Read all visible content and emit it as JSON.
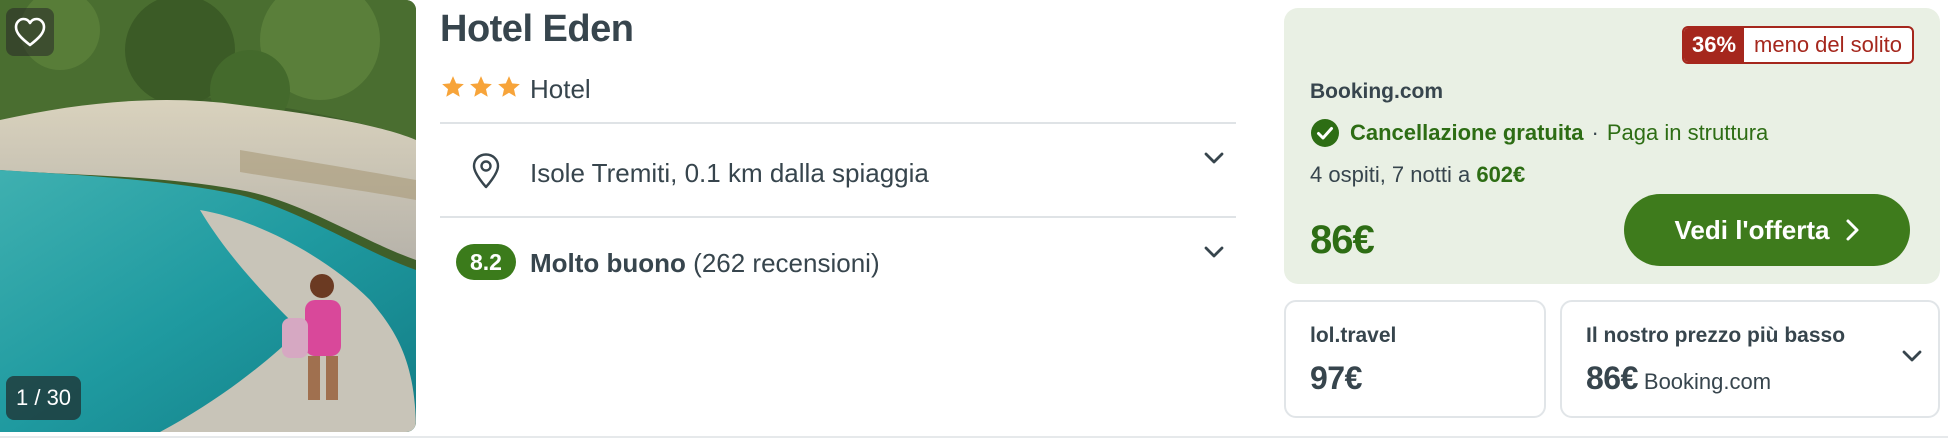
{
  "photo": {
    "counter": "1 / 30",
    "favorite_icon": "heart-outline-icon"
  },
  "hotel": {
    "name": "Hotel Eden",
    "stars": 3,
    "type": "Hotel",
    "location": "Isole Tremiti, 0.1 km dalla spiaggia",
    "rating_score": "8.2",
    "rating_label": "Molto buono",
    "reviews": "(262 recensioni)"
  },
  "offer": {
    "discount_pct": "36%",
    "discount_text": "meno del solito",
    "provider": "Booking.com",
    "cancellation": "Cancellazione gratuita",
    "separator": "·",
    "payment": "Paga in struttura",
    "stay_text": "4 ospiti, 7 notti a ",
    "stay_total": "602€",
    "price": "86€",
    "cta_label": "Vedi l'offerta"
  },
  "alternatives": [
    {
      "provider": "lol.travel",
      "price": "97€"
    },
    {
      "provider": "Il nostro prezzo più basso",
      "price": "86€",
      "source": "Booking.com"
    }
  ],
  "colors": {
    "brand_green": "#3e7b1c",
    "deal_bg": "#e9f0e4",
    "discount_red": "#a5271d",
    "star_orange": "#f7a43a"
  }
}
